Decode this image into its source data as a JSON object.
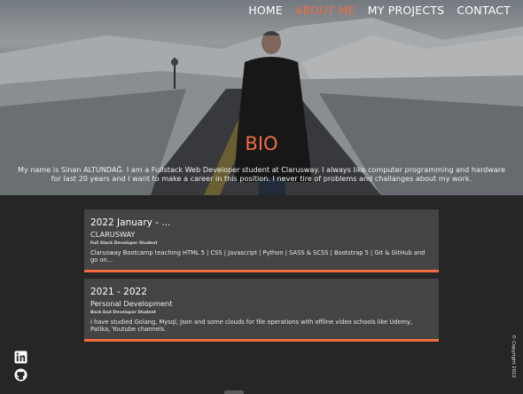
{
  "nav": {
    "items": [
      "HOME",
      "ABOUT ME",
      "MY PROJECTS",
      "CONTACT"
    ],
    "active": "ABOUT ME"
  },
  "bio": {
    "title": "BIO",
    "text": "My name is Sinan ALTUNDAĞ. I am a Fullstack Web Developer student at Clarusway. I always like computer programming and hardware for last 20 years and I want to make a career in this position. I never tire of problems and challanges about my work."
  },
  "timeline": [
    {
      "period": "2022 January - ...",
      "org": "CLARUSWAY",
      "role": "Full Stack Developer Student",
      "desc": "Clarusway Bootcamp teaching HTML 5 | CSS | Javascript | Python | SASS & SCSS | Bootstrap 5 | Git & GitHub and go on..."
    },
    {
      "period": "2021 - 2022",
      "org": "Personal Development",
      "role": "Back End Developer Student",
      "desc": "I have studied Golang, Mysql, Json and some clouds for file operations with offline video schools like Udemy, Patika, Youtube channels."
    }
  ],
  "social": [
    "linkedin-icon",
    "github-icon"
  ],
  "footer": {
    "copyright": "© Copyright 2022"
  },
  "colors": {
    "accent": "#f26c3f",
    "background": "#262626",
    "card": "#444444"
  }
}
